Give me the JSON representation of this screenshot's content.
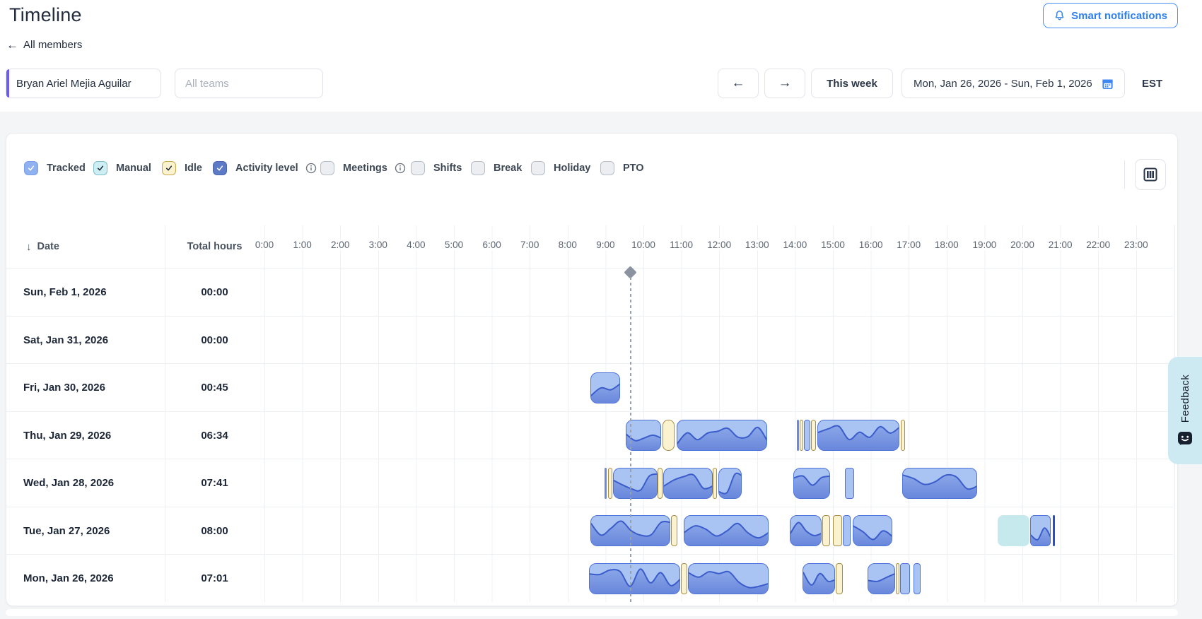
{
  "page": {
    "title": "Timeline",
    "back_label": "All members",
    "timezone": "EST"
  },
  "toolbar": {
    "smart_notifications": "Smart notifications",
    "this_week": "This week",
    "date_range": "Mon, Jan 26, 2026 - Sun, Feb 1, 2026"
  },
  "filters": {
    "member": "Bryan Ariel Mejia Aguilar",
    "teams_placeholder": "All teams"
  },
  "icons": {
    "back_arrow": "←",
    "prev_arrow": "←",
    "next_arrow": "→",
    "sort_desc": "↓"
  },
  "legend": {
    "items": [
      {
        "label": "Tracked",
        "checked": true,
        "style": "tracked",
        "info": false
      },
      {
        "label": "Manual",
        "checked": true,
        "style": "manual",
        "info": false
      },
      {
        "label": "Idle",
        "checked": true,
        "style": "idle",
        "info": false
      },
      {
        "label": "Activity level",
        "checked": true,
        "style": "activity",
        "info": true
      },
      {
        "label": "Meetings",
        "checked": false,
        "style": "off",
        "info": true
      },
      {
        "label": "Shifts",
        "checked": false,
        "style": "off",
        "info": false
      },
      {
        "label": "Break",
        "checked": false,
        "style": "off",
        "info": false
      },
      {
        "label": "Holiday",
        "checked": false,
        "style": "off",
        "info": false
      },
      {
        "label": "PTO",
        "checked": false,
        "style": "off",
        "info": false
      }
    ]
  },
  "table": {
    "date_header": "Date",
    "total_header": "Total hours",
    "time_labels": [
      "0:00",
      "1:00",
      "2:00",
      "3:00",
      "4:00",
      "5:00",
      "6:00",
      "7:00",
      "8:00",
      "9:00",
      "10:00",
      "11:00",
      "12:00",
      "13:00",
      "14:00",
      "15:00",
      "16:00",
      "17:00",
      "18:00",
      "19:00",
      "20:00",
      "21:00",
      "22:00",
      "23:00"
    ]
  },
  "timeline": {
    "current_time_hour": 9.66,
    "rows": [
      {
        "date": "Sun, Feb 1, 2026",
        "total": "00:00",
        "segments": []
      },
      {
        "date": "Sat, Jan 31, 2026",
        "total": "00:00",
        "segments": []
      },
      {
        "date": "Fri, Jan 30, 2026",
        "total": "00:45",
        "segments": [
          {
            "type": "tracked",
            "start": 8.6,
            "end": 9.39
          }
        ]
      },
      {
        "date": "Thu, Jan 29, 2026",
        "total": "06:34",
        "segments": [
          {
            "type": "tracked",
            "start": 9.53,
            "end": 10.46
          },
          {
            "type": "idle",
            "start": 10.5,
            "end": 10.83
          },
          {
            "type": "tracked",
            "start": 10.87,
            "end": 13.26
          },
          {
            "type": "tracked",
            "start": 14.04,
            "end": 14.11
          },
          {
            "type": "idle",
            "start": 14.13,
            "end": 14.22
          },
          {
            "type": "tracked",
            "start": 14.24,
            "end": 14.41
          },
          {
            "type": "idle",
            "start": 14.43,
            "end": 14.56
          },
          {
            "type": "tracked",
            "start": 14.58,
            "end": 16.76
          },
          {
            "type": "idle",
            "start": 16.79,
            "end": 16.9
          }
        ]
      },
      {
        "date": "Wed, Jan 28, 2026",
        "total": "07:41",
        "segments": [
          {
            "type": "tracked",
            "start": 8.98,
            "end": 9.04
          },
          {
            "type": "idle",
            "start": 9.06,
            "end": 9.18
          },
          {
            "type": "tracked",
            "start": 9.2,
            "end": 10.37
          },
          {
            "type": "idle",
            "start": 10.38,
            "end": 10.5
          },
          {
            "type": "tracked",
            "start": 10.52,
            "end": 11.82
          },
          {
            "type": "idle",
            "start": 11.83,
            "end": 11.95
          },
          {
            "type": "tracked",
            "start": 11.97,
            "end": 12.6
          },
          {
            "type": "tracked",
            "start": 13.95,
            "end": 14.92
          },
          {
            "type": "tracked",
            "start": 15.32,
            "end": 15.56
          },
          {
            "type": "tracked",
            "start": 16.83,
            "end": 18.8
          }
        ]
      },
      {
        "date": "Tue, Jan 27, 2026",
        "total": "08:00",
        "segments": [
          {
            "type": "tracked",
            "start": 8.6,
            "end": 10.71
          },
          {
            "type": "idle",
            "start": 10.72,
            "end": 10.9
          },
          {
            "type": "tracked",
            "start": 11.06,
            "end": 13.3
          },
          {
            "type": "tracked",
            "start": 13.87,
            "end": 14.71
          },
          {
            "type": "idle",
            "start": 14.72,
            "end": 14.93
          },
          {
            "type": "idle",
            "start": 14.99,
            "end": 15.25
          },
          {
            "type": "tracked",
            "start": 15.26,
            "end": 15.46
          },
          {
            "type": "tracked",
            "start": 15.53,
            "end": 16.57
          },
          {
            "type": "manual",
            "start": 19.35,
            "end": 20.18
          },
          {
            "type": "tracked",
            "start": 20.2,
            "end": 20.74
          },
          {
            "type": "tick",
            "start": 20.8,
            "end": 20.86
          }
        ]
      },
      {
        "date": "Mon, Jan 26, 2026",
        "total": "07:01",
        "segments": [
          {
            "type": "tracked",
            "start": 8.57,
            "end": 10.97
          },
          {
            "type": "idle",
            "start": 10.99,
            "end": 11.15
          },
          {
            "type": "tracked",
            "start": 11.17,
            "end": 13.3
          },
          {
            "type": "tracked",
            "start": 14.19,
            "end": 15.06
          },
          {
            "type": "idle",
            "start": 15.07,
            "end": 15.27
          },
          {
            "type": "tracked",
            "start": 15.92,
            "end": 16.65
          },
          {
            "type": "idle",
            "start": 16.66,
            "end": 16.76
          },
          {
            "type": "tracked",
            "start": 16.78,
            "end": 17.04
          },
          {
            "type": "tracked",
            "start": 17.13,
            "end": 17.32
          }
        ]
      }
    ]
  },
  "feedback": {
    "label": "Feedback"
  },
  "colors": {
    "accent_blue": "#2f80ed",
    "tracked_fill": "#a9c3f3",
    "tracked_border": "#4d72d8",
    "activity_line": "#3b5ccb",
    "idle_fill": "#fbf3d0",
    "idle_border": "#a58c49",
    "manual_fill": "#c6e9ee",
    "marker_gray": "#8b93a1",
    "member_accent": "#6c5bf0"
  }
}
